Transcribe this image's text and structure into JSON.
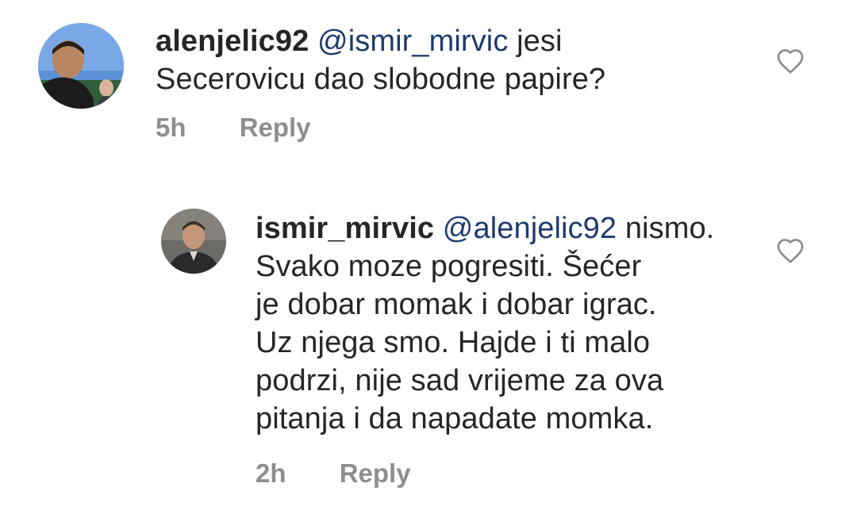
{
  "comments": [
    {
      "username": "alenjelic92",
      "mention": "@ismir_mirvic",
      "line1_rest": " jesi",
      "lines": [
        "Secerovicu dao slobodne papire?"
      ],
      "time": "5h",
      "reply_label": "Reply",
      "avatar_icon": "user-avatar-photo",
      "like_icon": "heart-outline-icon"
    },
    {
      "username": "ismir_mirvic",
      "mention": "@alenjelic92",
      "line1_rest": " nismo.",
      "lines": [
        "Svako moze pogresiti. Šećer",
        "je dobar momak i dobar igrac.",
        "Uz njega smo. Hajde i ti malo",
        "podrzi, nije sad vrijeme za ova",
        "pitanja i da napadate momka."
      ],
      "time": "2h",
      "reply_label": "Reply",
      "avatar_icon": "user-avatar-photo",
      "like_icon": "heart-outline-icon"
    }
  ],
  "colors": {
    "text": "#262626",
    "mention": "#1e3a6e",
    "meta": "#8e8e8e",
    "heart": "#8e8e8e"
  }
}
